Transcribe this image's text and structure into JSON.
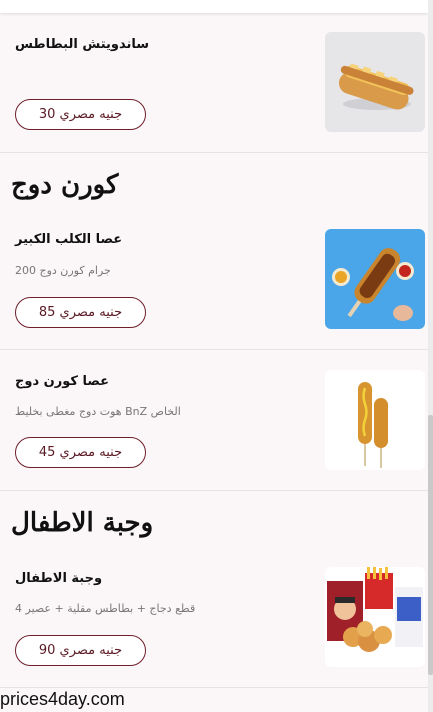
{
  "items_top": {
    "name": "ساندويتش البطاطس",
    "price": "جنيه مصري 30"
  },
  "section_corndog": {
    "title": "كورن دوج"
  },
  "item_big_stick": {
    "name": "عصا الكلب الكبير",
    "desc": "جرام كورن دوج 200",
    "price": "جنيه مصري 85"
  },
  "item_corndog_stick": {
    "name": "عصا كورن دوج",
    "desc": "الخاص BnZ هوت دوج مغطى بخليط",
    "price": "جنيه مصري 45"
  },
  "section_kids": {
    "title": "وجبة الاطفال"
  },
  "item_kids_meal": {
    "name": "وجبة الاطفال",
    "desc": "قطع دجاج + بطاطس مقلية + عصير 4",
    "price": "جنيه مصري 90"
  },
  "watermark": "prices4day.com"
}
